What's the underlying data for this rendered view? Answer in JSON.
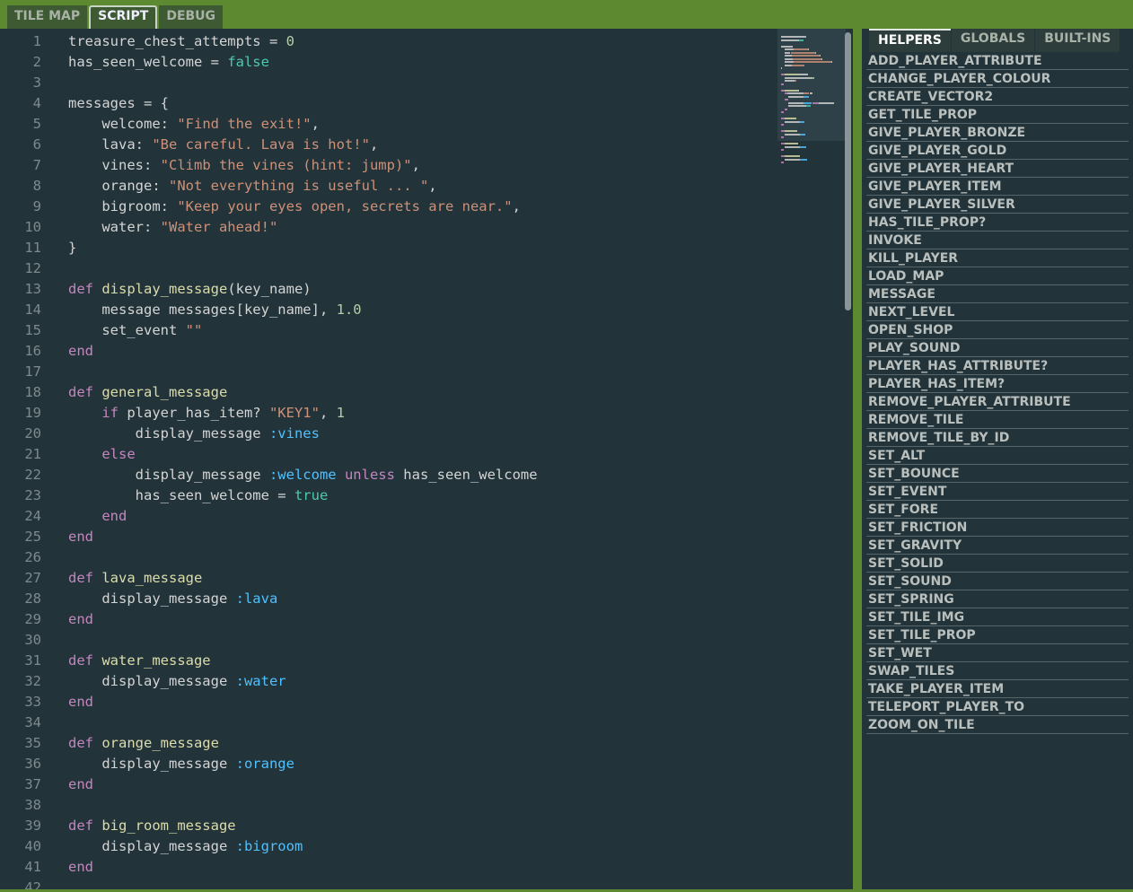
{
  "tabs": [
    {
      "label": "TILE MAP",
      "active": false
    },
    {
      "label": "SCRIPT",
      "active": true
    },
    {
      "label": "DEBUG",
      "active": false
    }
  ],
  "colors": {
    "background": "#5d8a30",
    "editor": "#22333a",
    "keyword": "#c586c0",
    "string": "#ce9178",
    "boolean": "#4ec9b0",
    "symbol": "#4fc1ff",
    "number": "#b5cea8",
    "function": "#dcdcaa"
  },
  "code": [
    [
      [
        "",
        "treasure_chest_attempts = "
      ],
      [
        "num",
        "0"
      ]
    ],
    [
      [
        "",
        "has_seen_welcome = "
      ],
      [
        "bool",
        "false"
      ]
    ],
    [],
    [
      [
        "",
        "messages = {"
      ]
    ],
    [
      [
        "",
        "    welcome: "
      ],
      [
        "str",
        "\"Find the exit!\""
      ],
      [
        "",
        ","
      ]
    ],
    [
      [
        "",
        "    lava: "
      ],
      [
        "str",
        "\"Be careful. Lava is hot!\""
      ],
      [
        "",
        ","
      ]
    ],
    [
      [
        "",
        "    vines: "
      ],
      [
        "str",
        "\"Climb the vines (hint: jump)\""
      ],
      [
        "",
        ","
      ]
    ],
    [
      [
        "",
        "    orange: "
      ],
      [
        "str",
        "\"Not everything is useful ... \""
      ],
      [
        "",
        ","
      ]
    ],
    [
      [
        "",
        "    bigroom: "
      ],
      [
        "str",
        "\"Keep your eyes open, secrets are near.\""
      ],
      [
        "",
        ","
      ]
    ],
    [
      [
        "",
        "    water: "
      ],
      [
        "str",
        "\"Water ahead!\""
      ]
    ],
    [
      [
        "",
        "}"
      ]
    ],
    [],
    [
      [
        "kw",
        "def "
      ],
      [
        "fn",
        "display_message"
      ],
      [
        "",
        "(key_name)"
      ]
    ],
    [
      [
        "",
        "    message messages[key_name], "
      ],
      [
        "num",
        "1.0"
      ]
    ],
    [
      [
        "",
        "    set_event "
      ],
      [
        "str",
        "\"\""
      ]
    ],
    [
      [
        "kw",
        "end"
      ]
    ],
    [],
    [
      [
        "kw",
        "def "
      ],
      [
        "fn",
        "general_message"
      ]
    ],
    [
      [
        "kw",
        "    if "
      ],
      [
        "",
        "player_has_item? "
      ],
      [
        "str",
        "\"KEY1\""
      ],
      [
        "",
        ", "
      ],
      [
        "num",
        "1"
      ]
    ],
    [
      [
        "",
        "        display_message "
      ],
      [
        "sym",
        ":vines"
      ]
    ],
    [
      [
        "kw",
        "    else"
      ]
    ],
    [
      [
        "",
        "        display_message "
      ],
      [
        "sym",
        ":welcome"
      ],
      [
        "kw",
        " unless "
      ],
      [
        "",
        "has_seen_welcome"
      ]
    ],
    [
      [
        "",
        "        has_seen_welcome = "
      ],
      [
        "bool",
        "true"
      ]
    ],
    [
      [
        "kw",
        "    end"
      ]
    ],
    [
      [
        "kw",
        "end"
      ]
    ],
    [],
    [
      [
        "kw",
        "def "
      ],
      [
        "fn",
        "lava_message"
      ]
    ],
    [
      [
        "",
        "    display_message "
      ],
      [
        "sym",
        ":lava"
      ]
    ],
    [
      [
        "kw",
        "end"
      ]
    ],
    [],
    [
      [
        "kw",
        "def "
      ],
      [
        "fn",
        "water_message"
      ]
    ],
    [
      [
        "",
        "    display_message "
      ],
      [
        "sym",
        ":water"
      ]
    ],
    [
      [
        "kw",
        "end"
      ]
    ],
    [],
    [
      [
        "kw",
        "def "
      ],
      [
        "fn",
        "orange_message"
      ]
    ],
    [
      [
        "",
        "    display_message "
      ],
      [
        "sym",
        ":orange"
      ]
    ],
    [
      [
        "kw",
        "end"
      ]
    ],
    [],
    [
      [
        "kw",
        "def "
      ],
      [
        "fn",
        "big_room_message"
      ]
    ],
    [
      [
        "",
        "    display_message "
      ],
      [
        "sym",
        ":bigroom"
      ]
    ],
    [
      [
        "kw",
        "end"
      ]
    ],
    []
  ],
  "panel": {
    "tabs": [
      {
        "label": "HELPERS",
        "active": true
      },
      {
        "label": "GLOBALS",
        "active": false
      },
      {
        "label": "BUILT-INS",
        "active": false
      }
    ],
    "items": [
      "ADD_PLAYER_ATTRIBUTE",
      "CHANGE_PLAYER_COLOUR",
      "CREATE_VECTOR2",
      "GET_TILE_PROP",
      "GIVE_PLAYER_BRONZE",
      "GIVE_PLAYER_GOLD",
      "GIVE_PLAYER_HEART",
      "GIVE_PLAYER_ITEM",
      "GIVE_PLAYER_SILVER",
      "HAS_TILE_PROP?",
      "INVOKE",
      "KILL_PLAYER",
      "LOAD_MAP",
      "MESSAGE",
      "NEXT_LEVEL",
      "OPEN_SHOP",
      "PLAY_SOUND",
      "PLAYER_HAS_ATTRIBUTE?",
      "PLAYER_HAS_ITEM?",
      "REMOVE_PLAYER_ATTRIBUTE",
      "REMOVE_TILE",
      "REMOVE_TILE_BY_ID",
      "SET_ALT",
      "SET_BOUNCE",
      "SET_EVENT",
      "SET_FORE",
      "SET_FRICTION",
      "SET_GRAVITY",
      "SET_SOLID",
      "SET_SOUND",
      "SET_SPRING",
      "SET_TILE_IMG",
      "SET_TILE_PROP",
      "SET_WET",
      "SWAP_TILES",
      "TAKE_PLAYER_ITEM",
      "TELEPORT_PLAYER_TO",
      "ZOOM_ON_TILE"
    ]
  }
}
